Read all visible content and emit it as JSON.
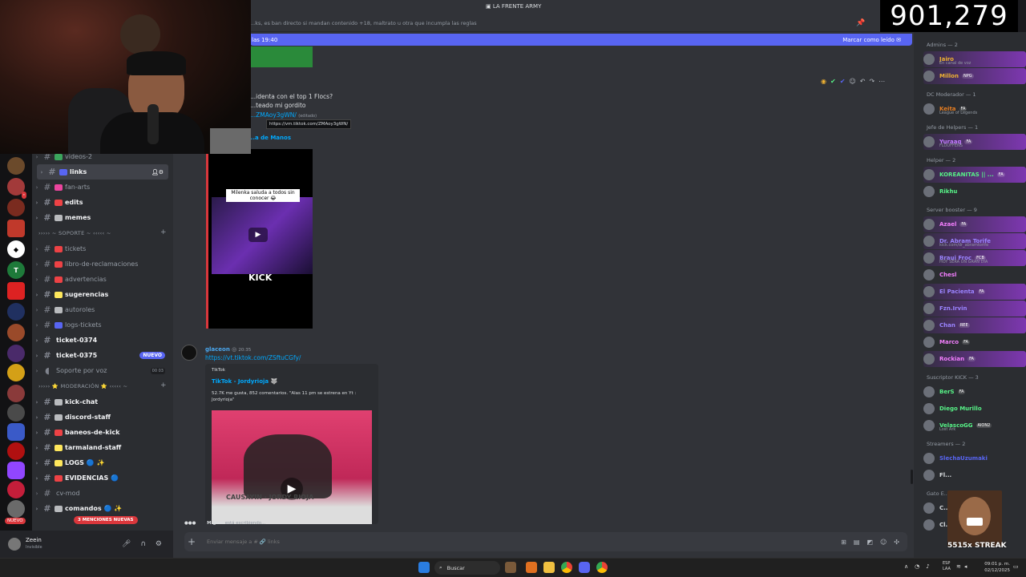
{
  "window_title": "LA FRENTE ARMY",
  "viewer_count": "901,279",
  "channel_topic": "...ks, es ban directo si mandan contenido +18, maltrato u otra que incumpla las reglas",
  "unread_banner": {
    "text": "las 19:40",
    "action": "Marcar como leído"
  },
  "message1": {
    "line1": "...identa con el top 1 Flocs?",
    "line2": "...teado mi gordito",
    "link_text": "...ZMAoy3gWN/",
    "edited": "(editado)",
    "tooltip": "https://vm.tiktok.com/ZMAoy3gWN/",
    "embed_title": "...a de Manos",
    "video_caption": "Milenka saluda a todos sin conocer 😂",
    "video_brand": "KICK"
  },
  "message2": {
    "author": "glaceon",
    "time": "20:35",
    "link": "https://vt.tiktok.com/ZSftuCGfy/",
    "embed_provider": "TikTok",
    "embed_title": "TikTok - Jordyrioja 🐺",
    "embed_desc": "52.7K me gusta, 852 comentarios. \"Alas 11 pm se estrena en Yt : Jordyrioja\"",
    "thumb_text": "CAUSAYIN · JORDY RIOJA"
  },
  "typing": {
    "user": "Miguel",
    "text": "está escribiendo..."
  },
  "composer_placeholder": "Enviar mensaje a # 🔗 links",
  "channels": [
    {
      "name": "videos-2",
      "bright": false,
      "color": "#3ba55c"
    },
    {
      "name": "links",
      "bright": true,
      "active": true,
      "color": "#5865f2"
    },
    {
      "name": "fan-arts",
      "bright": false,
      "color": "#eb459e"
    },
    {
      "name": "edits",
      "bright": true,
      "color": "#ed4245"
    },
    {
      "name": "memes",
      "bright": true,
      "color": "#b9bbbe"
    }
  ],
  "cat_soporte": "››››› ~ SOPORTE ~ ‹‹‹‹‹ ~",
  "channels_soporte": [
    {
      "name": "tickets",
      "bright": false,
      "color": "#ed4245"
    },
    {
      "name": "libro-de-reclamaciones",
      "bright": false,
      "color": "#ed4245"
    },
    {
      "name": "advertencias",
      "bright": false,
      "color": "#ed4245"
    },
    {
      "name": "sugerencias",
      "bright": true,
      "color": "#fee75c"
    },
    {
      "name": "autoroles",
      "bright": false,
      "color": "#b9bbbe"
    },
    {
      "name": "logs-tickets",
      "bright": false,
      "color": "#5865f2"
    },
    {
      "name": "ticket-0374",
      "bright": true,
      "color": ""
    },
    {
      "name": "ticket-0375",
      "bright": true,
      "color": "",
      "badge": "NUEVO"
    },
    {
      "name": "Soporte por voz",
      "bright": false,
      "color": "",
      "voice": "00 03"
    }
  ],
  "cat_moderacion": "››››› ⭐ MODERACIÓN ⭐ ‹‹‹‹‹ ~",
  "channels_mod": [
    {
      "name": "kick-chat",
      "bright": true,
      "color": "#b9bbbe"
    },
    {
      "name": "discord-staff",
      "bright": true,
      "color": "#b9bbbe"
    },
    {
      "name": "baneos-de-kick",
      "bright": true,
      "color": "#ed4245"
    },
    {
      "name": "tarmaland-staff",
      "bright": true,
      "color": "#fee75c"
    },
    {
      "name": "LOGS 🔵 ✨",
      "bright": true,
      "color": "#fee75c"
    },
    {
      "name": "EVIDENCIAS 🔵",
      "bright": true,
      "color": "#ed4245"
    },
    {
      "name": "cv-mod",
      "bright": false,
      "color": ""
    },
    {
      "name": "comandos 🔵 ✨",
      "bright": true,
      "color": "#b9bbbe"
    }
  ],
  "mentions_pill": "3 MENCIONES NUEVAS",
  "nuevo_rail": "NUEVO",
  "user": {
    "name": "Zeein",
    "status": "Invisible"
  },
  "members": {
    "groups": [
      {
        "header": "Admins — 2",
        "members": [
          {
            "name": "Jairo",
            "color": "#f0b232",
            "sub": "En canal de voz",
            "banner": true
          },
          {
            "name": "Millon",
            "color": "#f0b232",
            "tag": "NPG",
            "banner": true
          }
        ]
      },
      {
        "header": "DC Moderador — 1",
        "members": [
          {
            "name": "Keita",
            "color": "#e67e22",
            "tag": "FA",
            "sub": "League of Legends"
          }
        ]
      },
      {
        "header": "Jefe de Helpers — 1",
        "members": [
          {
            "name": "Yuraaq",
            "color": "#c27cff",
            "tag": "FA",
            "sub": "FLOUFFENS",
            "banner": true
          }
        ]
      },
      {
        "header": "Helper — 2",
        "members": [
          {
            "name": "KOREANITAS || ...",
            "color": "#57f287",
            "tag": "FA",
            "banner": true
          },
          {
            "name": "Rikhu",
            "color": "#57f287"
          }
        ]
      },
      {
        "header": "Server booster — 9",
        "members": [
          {
            "name": "Azael",
            "color": "#f47fff",
            "tag": "FA",
            "banner": true
          },
          {
            "name": "Dr. Abram Torife",
            "color": "#9b84ff",
            "sub": "kick.com/dr_abramtorife",
            "banner": true
          },
          {
            "name": "Braui Froc",
            "color": "#9b84ff",
            "tag": "FCB",
            "sub": "HOY SERA UN GRAN DIA",
            "banner": true
          },
          {
            "name": "Chesl",
            "color": "#f47fff"
          },
          {
            "name": "El Pacienta",
            "color": "#9b84ff",
            "tag": "FA",
            "banner": true
          },
          {
            "name": "Fzn.Irvin",
            "color": "#9b84ff",
            "banner": true
          },
          {
            "name": "Chan",
            "color": "#9b84ff",
            "tag": "REE",
            "banner": true
          },
          {
            "name": "Marco",
            "color": "#f47fff",
            "tag": "FA"
          },
          {
            "name": "Rockian",
            "color": "#f47fff",
            "tag": "FA",
            "banner": true
          }
        ]
      },
      {
        "header": "Suscriptor KICK — 3",
        "members": [
          {
            "name": "BerS",
            "color": "#57f287",
            "tag": "FA"
          },
          {
            "name": "Diego Murillo",
            "color": "#57f287"
          },
          {
            "name": "VelascoGG",
            "color": "#57f287",
            "tag": "AION2",
            "sub": "Lost Ark"
          }
        ]
      },
      {
        "header": "Streamers — 2",
        "members": [
          {
            "name": "SlechaUzumaki",
            "color": "#5865f2"
          },
          {
            "name": "Fl...",
            "color": "#dbdee1"
          }
        ]
      },
      {
        "header": "Gato E...",
        "members": [
          {
            "name": "C...",
            "color": "#dbdee1"
          },
          {
            "name": "Cl...",
            "color": "#dbdee1"
          }
        ]
      }
    ]
  },
  "streak": "5515x STREAK",
  "taskbar": {
    "search": "Buscar",
    "lang": "ESP\nLAA",
    "time": "09:01 p. m.",
    "date": "02/12/2025"
  }
}
